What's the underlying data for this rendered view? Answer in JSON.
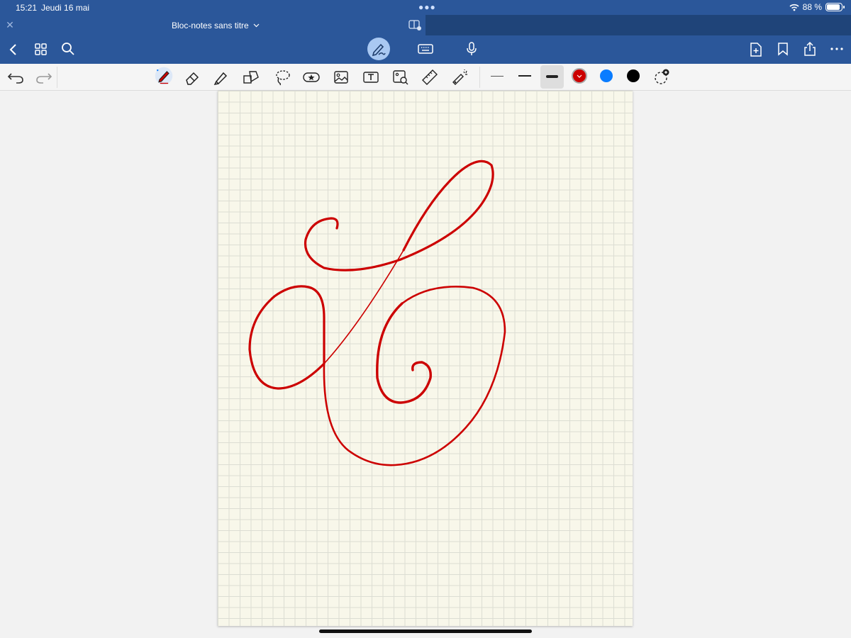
{
  "status": {
    "time": "15:21",
    "date": "Jeudi 16 mai",
    "battery": "88 %",
    "battery_level": 0.88
  },
  "tab": {
    "title": "Bloc-notes sans titre"
  },
  "colors": {
    "accent": "#2b579a",
    "ink_red": "#cc0000",
    "blue": "#0a7cff",
    "black": "#000000",
    "page": "#f8f7ea"
  },
  "toolbar": {
    "left_icons": [
      "back-icon",
      "grid-icon",
      "search-icon"
    ],
    "center_icons": [
      "pen-icon",
      "keyboard-icon",
      "microphone-icon"
    ],
    "right_icons": [
      "add-page-icon",
      "bookmark-icon",
      "share-icon",
      "more-icon"
    ]
  },
  "drawing_tools": [
    "undo-icon",
    "redo-icon",
    "pen-tool-icon",
    "eraser-icon",
    "highlighter-icon",
    "shapes-icon",
    "lasso-icon",
    "sticker-icon",
    "image-icon",
    "text-box-icon",
    "image-search-icon",
    "ruler-icon",
    "laser-pointer-icon"
  ],
  "stroke_widths": [
    "thin",
    "medium",
    "thick"
  ],
  "selected_stroke": "thick",
  "palette": [
    "#cc0000",
    "#0a7cff",
    "#000000"
  ],
  "selected_color": "#cc0000"
}
